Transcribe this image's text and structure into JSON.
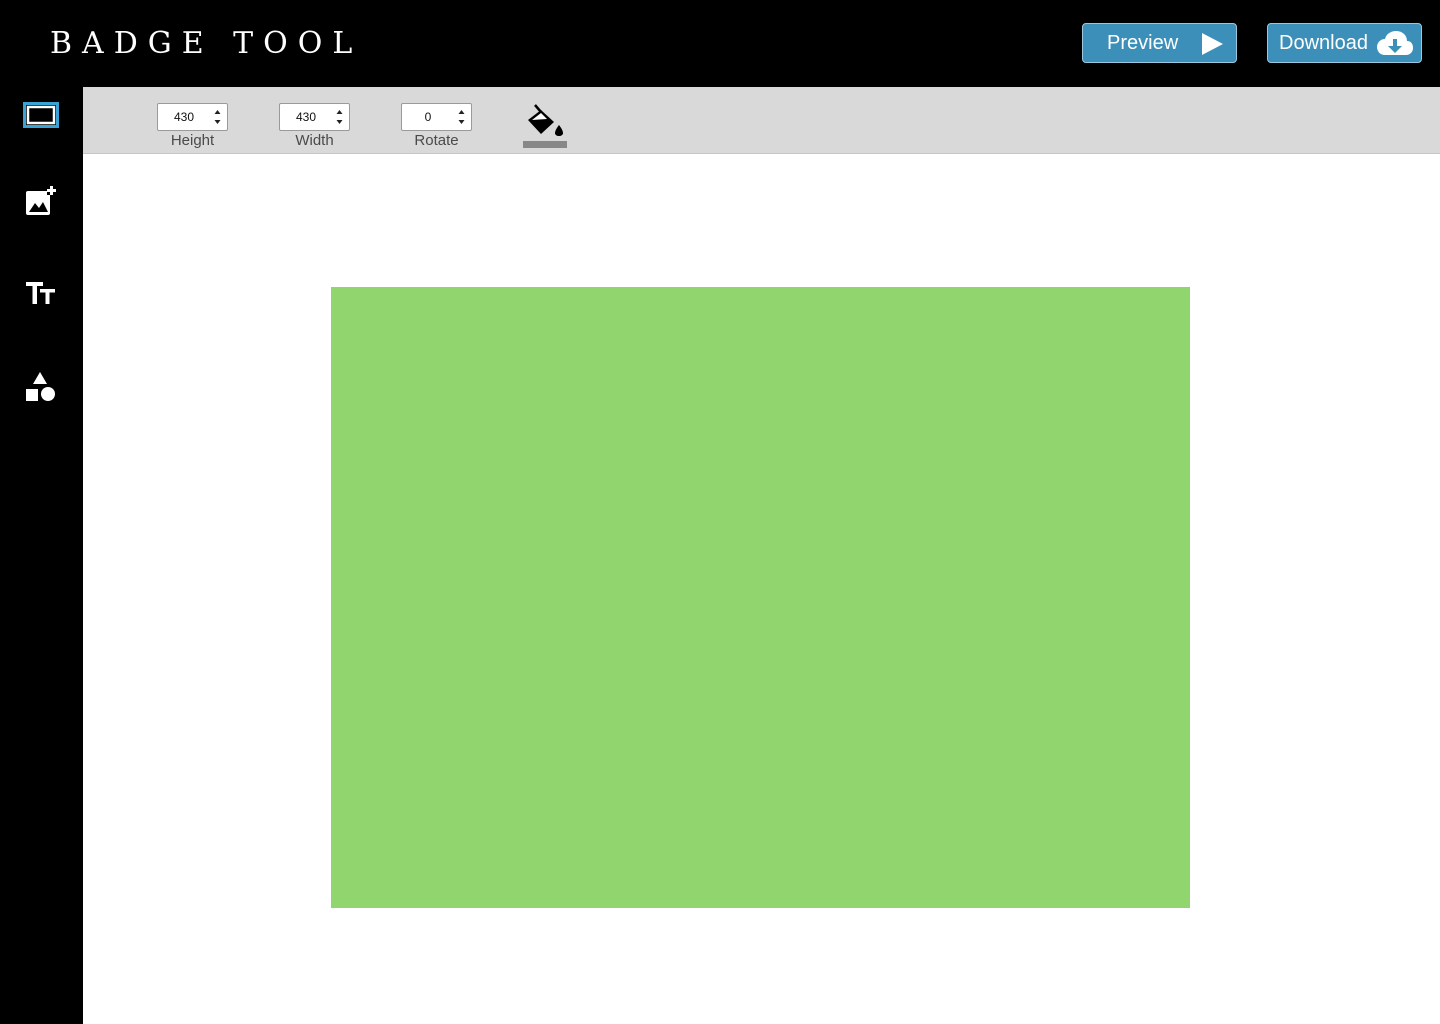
{
  "header": {
    "title": "BADGE TOOL",
    "preview_label": "Preview",
    "download_label": "Download"
  },
  "sidebar": {
    "tools": [
      {
        "name": "rectangle-tool",
        "icon": "rectangle-icon",
        "active": true
      },
      {
        "name": "add-image-tool",
        "icon": "add-photo-icon",
        "active": false
      },
      {
        "name": "text-tool",
        "icon": "text-size-icon",
        "active": false
      },
      {
        "name": "shapes-tool",
        "icon": "shapes-icon",
        "active": false
      }
    ]
  },
  "toolbar": {
    "height": {
      "value": "430",
      "label": "Height"
    },
    "width": {
      "value": "430",
      "label": "Width"
    },
    "rotate": {
      "value": "0",
      "label": "Rotate"
    },
    "fill": {
      "icon": "paint-bucket-icon",
      "current_color": "#888888"
    }
  },
  "canvas": {
    "fill_color": "#90d56d"
  },
  "colors": {
    "header_bg": "#000000",
    "button_bg": "#3c8fb8",
    "active_tool_border": "#3aa3d6",
    "toolbar_bg": "#d9d9d9"
  }
}
